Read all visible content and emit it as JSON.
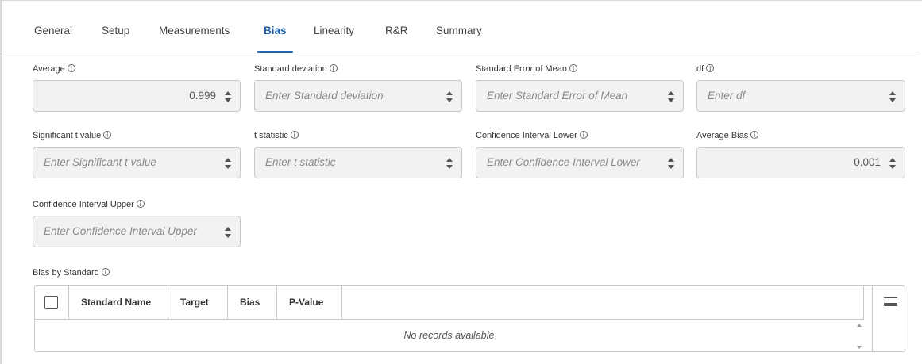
{
  "tabs": [
    {
      "label": "General",
      "active": false
    },
    {
      "label": "Setup",
      "active": false
    },
    {
      "label": "Measurements",
      "active": false
    },
    {
      "label": "Bias",
      "active": true
    },
    {
      "label": "Linearity",
      "active": false
    },
    {
      "label": "R&R",
      "active": false
    },
    {
      "label": "Summary",
      "active": false
    }
  ],
  "info_glyph": "i",
  "fields": {
    "average": {
      "label": "Average",
      "value": "0.999"
    },
    "standard_deviation": {
      "label": "Standard deviation",
      "placeholder": "Enter Standard deviation"
    },
    "standard_error_of_mean": {
      "label": "Standard Error of Mean",
      "placeholder": "Enter Standard Error of Mean"
    },
    "df": {
      "label": "df",
      "placeholder": "Enter df"
    },
    "significant_t_value": {
      "label": "Significant t value",
      "placeholder": "Enter Significant t value"
    },
    "t_statistic": {
      "label": "t statistic",
      "placeholder": "Enter t statistic"
    },
    "confidence_interval_lower": {
      "label": "Confidence Interval Lower",
      "placeholder": "Enter Confidence Interval Lower"
    },
    "average_bias": {
      "label": "Average Bias",
      "value": "0.001"
    },
    "confidence_interval_upper": {
      "label": "Confidence Interval Upper",
      "placeholder": "Enter Confidence Interval Upper"
    }
  },
  "bias_table": {
    "title": "Bias by Standard",
    "columns": [
      "Standard Name",
      "Target",
      "Bias",
      "P-Value"
    ],
    "empty_message": "No records available"
  },
  "colors": {
    "accent": "#2566ae",
    "input_bg": "#f2f2f2",
    "border": "#c9c9c9"
  },
  "icons": {
    "info": "info-icon",
    "spinner": "spinner-icon",
    "column_menu": "column-menu-icon"
  }
}
